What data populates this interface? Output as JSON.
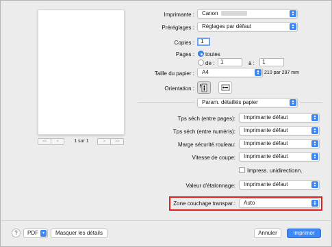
{
  "printer": {
    "label": "Imprimante :",
    "value": "Canon"
  },
  "presets": {
    "label": "Préréglages :",
    "value": "Réglages par défaut"
  },
  "copies": {
    "label": "Copies :",
    "value": "1"
  },
  "pages": {
    "label": "Pages :",
    "all_label": "toutes",
    "from_label": "de :",
    "from_value": "1",
    "to_label": "à :",
    "to_value": "1"
  },
  "paper_size": {
    "label": "Taille du papier :",
    "value": "A4",
    "dimensions": "210 par 297 mm"
  },
  "orientation": {
    "label": "Orientation :"
  },
  "section": {
    "value": "Param. détaillés papier"
  },
  "settings": {
    "drying_pages": {
      "label": "Tps séch (entre pages):",
      "value": "Imprimante défaut"
    },
    "drying_scans": {
      "label": "Tps séch (entre numéris):",
      "value": "Imprimante défaut"
    },
    "roll_margin": {
      "label": "Marge sécurité rouleau:",
      "value": "Imprimante défaut"
    },
    "cut_speed": {
      "label": "Vitesse de coupe:",
      "value": "Imprimante défaut"
    },
    "unidirectional": {
      "label": "Impress. unidirectionn."
    },
    "calibration": {
      "label": "Valeur d'étalonnage:",
      "value": "Imprimante défaut"
    },
    "transparent_zone": {
      "label": "Zone couchage transpar.:",
      "value": "Auto"
    }
  },
  "preview": {
    "first": "<<",
    "prev": "<",
    "page_indicator": "1 sur 1",
    "next": ">",
    "last": ">>"
  },
  "footer": {
    "help": "?",
    "pdf": "PDF",
    "hide_details": "Masquer les détails",
    "cancel": "Annuler",
    "print": "Imprimer"
  },
  "colors": {
    "accent": "#3d86f5",
    "highlight_border": "#e0201c"
  }
}
